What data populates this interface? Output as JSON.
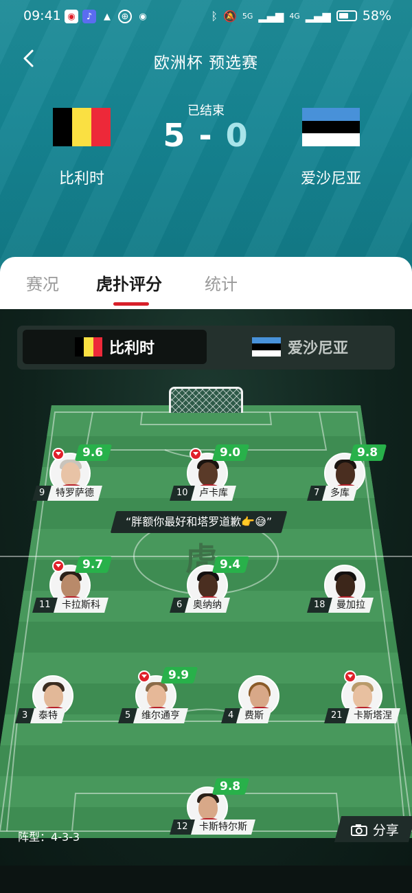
{
  "status_bar": {
    "time": "09:41",
    "battery": "58%",
    "signal_labels": [
      "5G",
      "4G"
    ]
  },
  "header": {
    "title": "欧洲杯 预选赛"
  },
  "match": {
    "status": "已结束",
    "home": {
      "name": "比利时",
      "score": "5",
      "flag_colors": [
        "#000000",
        "#FAE042",
        "#ED2939"
      ]
    },
    "score_separator": "-",
    "away": {
      "name": "爱沙尼亚",
      "score": "0",
      "flag_colors": [
        "#4891D9",
        "#000000",
        "#FFFFFF"
      ]
    }
  },
  "tabs": [
    {
      "label": "赛况",
      "active": false
    },
    {
      "label": "虎扑评分",
      "active": true
    },
    {
      "label": "统计",
      "active": false
    }
  ],
  "team_switch": {
    "home_label": "比利时",
    "away_label": "爱沙尼亚",
    "selected": "比利时"
  },
  "players": [
    {
      "number": "9",
      "name": "特罗萨德",
      "rating": "9.6",
      "liked": true
    },
    {
      "number": "10",
      "name": "卢卡库",
      "rating": "9.0",
      "liked": true
    },
    {
      "number": "7",
      "name": "多库",
      "rating": "9.8",
      "liked": false
    },
    {
      "number": "11",
      "name": "卡拉斯科",
      "rating": "9.7",
      "liked": true
    },
    {
      "number": "6",
      "name": "奥纳纳",
      "rating": "9.4",
      "liked": false
    },
    {
      "number": "18",
      "name": "曼加拉",
      "rating": "",
      "liked": false
    },
    {
      "number": "3",
      "name": "泰特",
      "rating": "",
      "liked": false
    },
    {
      "number": "5",
      "name": "维尔通亨",
      "rating": "9.9",
      "liked": true
    },
    {
      "number": "4",
      "name": "费斯",
      "rating": "",
      "liked": false
    },
    {
      "number": "21",
      "name": "卡斯塔涅",
      "rating": "",
      "liked": true
    },
    {
      "number": "12",
      "name": "卡斯特尔斯",
      "rating": "9.8",
      "liked": false
    }
  ],
  "comment": "“胖额你最好和塔罗道歉👉😅”",
  "formation": {
    "label": "阵型：",
    "value": "4-3-3"
  },
  "share": {
    "label": "分享"
  },
  "colors": {
    "accent": "#d8202a",
    "rating_green": "#28b14a",
    "header_teal": "#168593"
  }
}
